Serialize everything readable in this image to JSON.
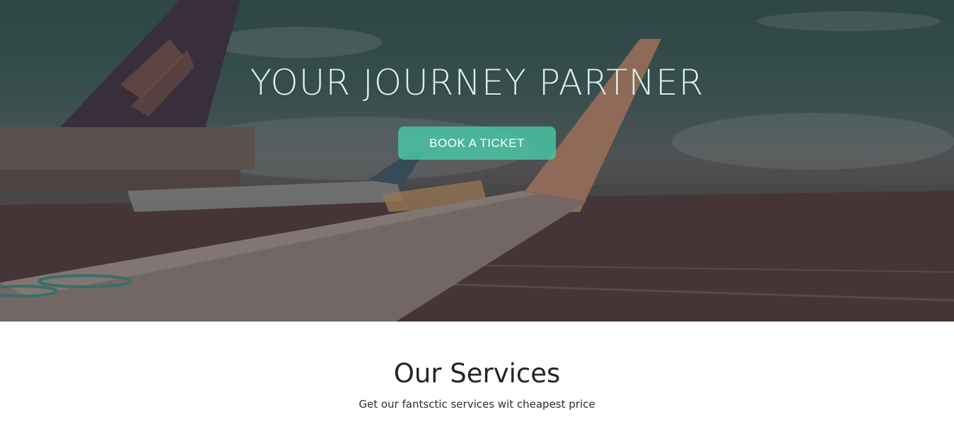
{
  "hero": {
    "title": "YOUR JOURNEY PARTNER",
    "cta_label": "BOOK A TICKET",
    "background_image": "airport-tarmac-airplanes",
    "overlay_color": "#2d5450",
    "accent_color": "#48cdaa"
  },
  "services": {
    "title": "Our Services",
    "subtitle": "Get our fantsctic services wit cheapest price"
  }
}
